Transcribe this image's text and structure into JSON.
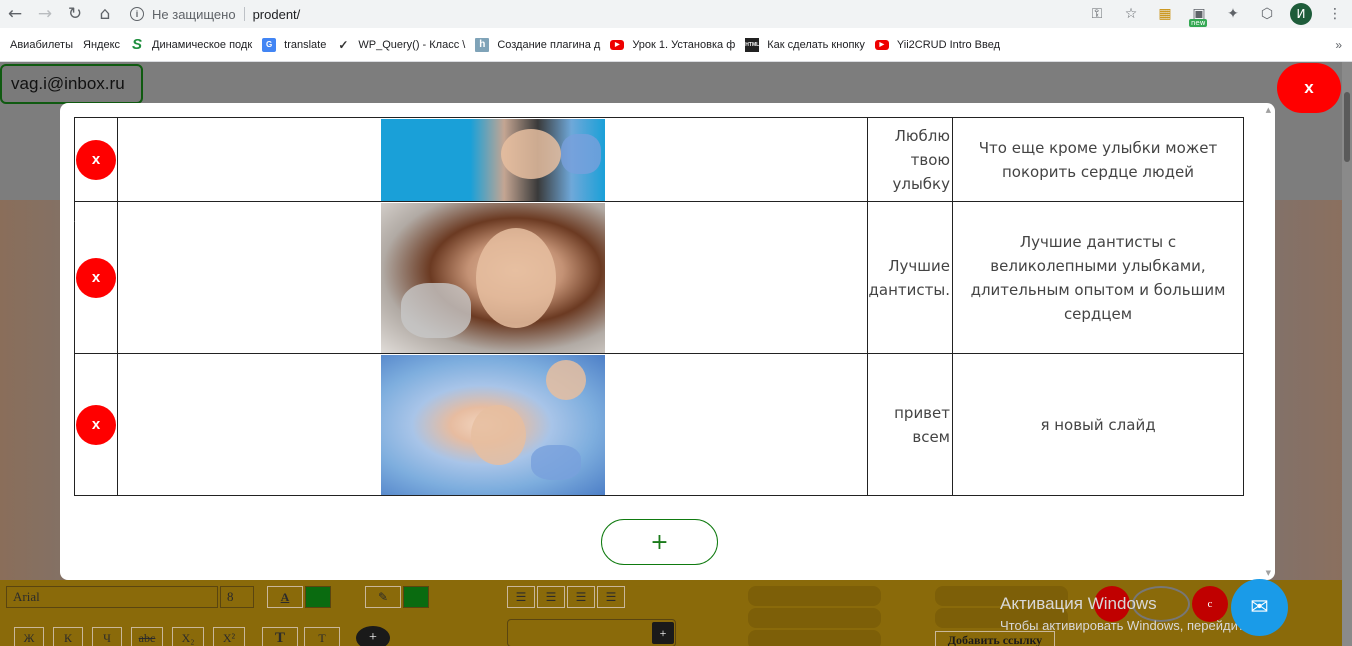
{
  "browser": {
    "address_insecure": "Не защищено",
    "address_url": "prodent/",
    "avatar_letter": "И",
    "new_badge": "new",
    "icons": [
      "back-icon",
      "forward-icon",
      "reload-icon",
      "home-icon",
      "key-icon",
      "star-icon",
      "extension-icon",
      "menu-icon"
    ]
  },
  "bookmarks": [
    {
      "label": "Авиабилеты",
      "icon": "page"
    },
    {
      "label": "Яндекс",
      "icon": "page"
    },
    {
      "label": "Динамическое подк",
      "icon": "s"
    },
    {
      "label": "translate",
      "icon": "gt"
    },
    {
      "label": "WP_Query() - Класс \\",
      "icon": "wp"
    },
    {
      "label": "Создание плагина д",
      "icon": "h"
    },
    {
      "label": "Урок 1. Установка ф",
      "icon": "yt"
    },
    {
      "label": "Как сделать кнопку",
      "icon": "html"
    },
    {
      "label": "Yii2CRUD Intro Введ",
      "icon": "yt"
    }
  ],
  "page": {
    "user_email": "vag.i@inbox.ru",
    "close_label": "x"
  },
  "modal": {
    "add_label": "+",
    "slides": [
      {
        "delete_label": "x",
        "title": "Люблю твою улыбку",
        "description": "Что еще кроме улыбки может покорить сердце людей"
      },
      {
        "delete_label": "x",
        "title": "Лучшие дантисты.",
        "description": "Лучшие дантисты с великолепными улыбками, длительным опытом и большим сердцем"
      },
      {
        "delete_label": "x",
        "title": "привет всем",
        "description": "я новый слайд"
      }
    ]
  },
  "editor": {
    "font_name": "Arial",
    "font_size": "8",
    "text_color_label": "A",
    "format_buttons": [
      "Ж",
      "К",
      "Ч",
      "abc",
      "X₂",
      "X²"
    ],
    "t_buttons": [
      "T",
      "T"
    ],
    "plus_label": "+",
    "add_link_label": "Добавить ссылку"
  },
  "watermark": {
    "line1": "Активация Windows",
    "line2": "Чтобы активировать Windows, перейдите в"
  },
  "colors": {
    "danger": "#ff0000",
    "accent_green": "#0f7a0f",
    "chat_blue": "#1a9be8",
    "editor_bg": "#8a6a0a"
  }
}
